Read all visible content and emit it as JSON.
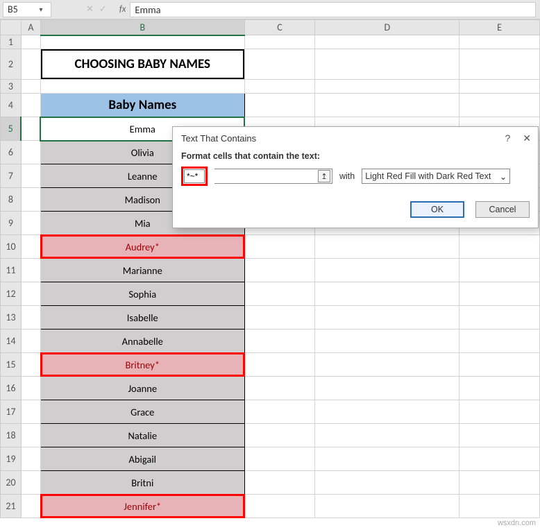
{
  "cellRef": "B5",
  "formula": "Emma",
  "fx": "fx",
  "heading": "CHOOSING BABY NAMES",
  "tableHeader": "Baby Names",
  "cols": [
    "A",
    "B",
    "C",
    "D",
    "E"
  ],
  "rows": [
    "1",
    "2",
    "3",
    "4",
    "5",
    "6",
    "7",
    "8",
    "9",
    "10",
    "11",
    "12",
    "13",
    "14",
    "15",
    "16",
    "17",
    "18",
    "19",
    "20",
    "21"
  ],
  "names": [
    {
      "v": "Emma",
      "cf": false,
      "hl": false
    },
    {
      "v": "Olivia",
      "cf": false,
      "hl": false
    },
    {
      "v": "Leanne",
      "cf": false,
      "hl": false
    },
    {
      "v": "Madison",
      "cf": false,
      "hl": false
    },
    {
      "v": "Mia",
      "cf": false,
      "hl": false
    },
    {
      "v": "Audrey*",
      "cf": true,
      "hl": true
    },
    {
      "v": "Marianne",
      "cf": false,
      "hl": false
    },
    {
      "v": "Sophia",
      "cf": false,
      "hl": false
    },
    {
      "v": "Isabelle",
      "cf": false,
      "hl": false
    },
    {
      "v": "Annabelle",
      "cf": false,
      "hl": false
    },
    {
      "v": "Britney*",
      "cf": true,
      "hl": true
    },
    {
      "v": "Joanne",
      "cf": false,
      "hl": false
    },
    {
      "v": "Grace",
      "cf": false,
      "hl": false
    },
    {
      "v": "Natalie",
      "cf": false,
      "hl": false
    },
    {
      "v": "Abigail",
      "cf": false,
      "hl": false
    },
    {
      "v": "Britni",
      "cf": false,
      "hl": false
    },
    {
      "v": "Jennifer*",
      "cf": true,
      "hl": true
    }
  ],
  "dialog": {
    "title": "Text That Contains",
    "label": "Format cells that contain the text:",
    "value": "*~*",
    "with": "with",
    "format": "Light Red Fill with Dark Red Text",
    "ok": "OK",
    "cancel": "Cancel",
    "help": "?",
    "close": "✕"
  },
  "watermark": "wsxdn.com"
}
